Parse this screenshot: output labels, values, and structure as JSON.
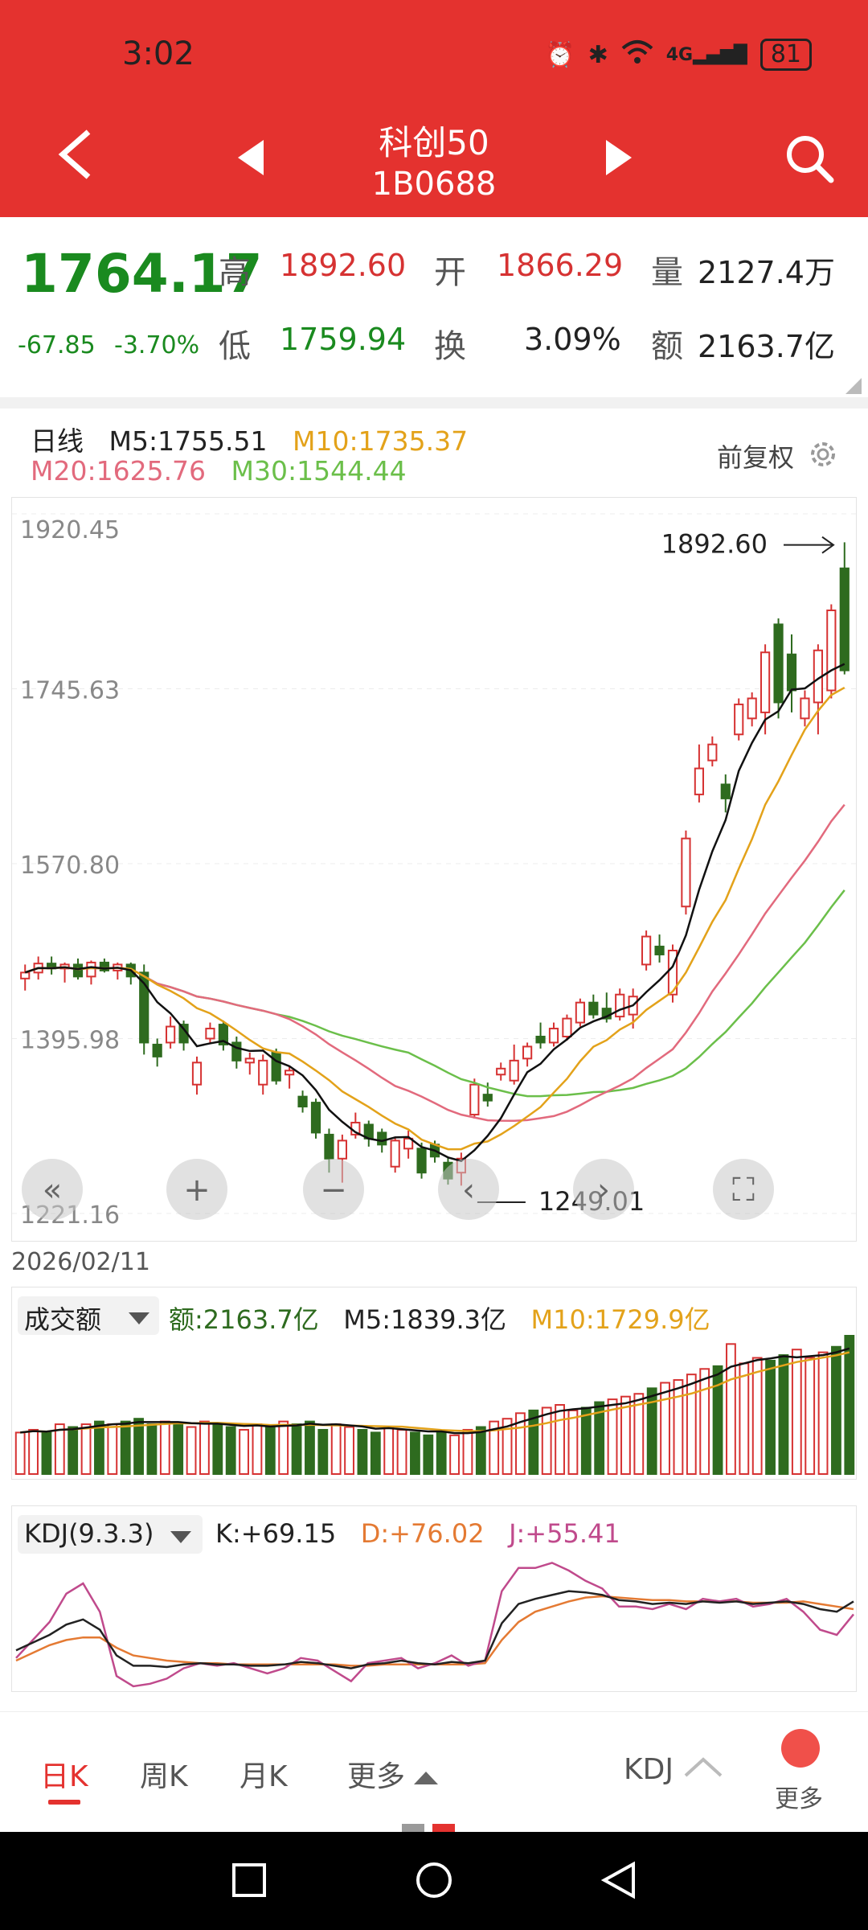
{
  "status": {
    "time": "3:02",
    "network": "4G",
    "battery": "81"
  },
  "header": {
    "title": "科创50",
    "code": "1B0688"
  },
  "quote": {
    "price": "1764.17",
    "change": "-67.85",
    "change_pct": "-3.70%",
    "high_label": "高",
    "high": "1892.60",
    "open_label": "开",
    "open": "1866.29",
    "volume_label": "量",
    "volume": "2127.4万",
    "low_label": "低",
    "low": "1759.94",
    "turnover_label": "换",
    "turnover": "3.09%",
    "amount_label": "额",
    "amount": "2163.7亿"
  },
  "ma_legend": {
    "period": "日线",
    "m5": "M5:1755.51",
    "m10": "M10:1735.37",
    "m20": "M20:1625.76",
    "m30": "M30:1544.44",
    "adjust": "前复权"
  },
  "colors": {
    "up": "#d63232",
    "down": "#2e6b1f",
    "m5": "#111111",
    "m10": "#e3a21a",
    "m20": "#e26a7d",
    "m30": "#6bbf4a",
    "accent": "#e4322f"
  },
  "chart_data": [
    {
      "type": "candlestick",
      "title": "",
      "y_ticks": [
        "1920.45",
        "1745.63",
        "1570.80",
        "1395.98",
        "1221.16"
      ],
      "ylim": [
        1221.16,
        1920.45
      ],
      "x_date": "2026/02/11",
      "high_marker": "1892.60",
      "low_marker": "1249.01",
      "candles": [
        {
          "o": 1456,
          "h": 1470,
          "l": 1444,
          "c": 1462
        },
        {
          "o": 1462,
          "h": 1478,
          "l": 1455,
          "c": 1471
        },
        {
          "o": 1471,
          "h": 1478,
          "l": 1460,
          "c": 1466
        },
        {
          "o": 1466,
          "h": 1472,
          "l": 1452,
          "c": 1470
        },
        {
          "o": 1470,
          "h": 1476,
          "l": 1455,
          "c": 1458
        },
        {
          "o": 1458,
          "h": 1474,
          "l": 1450,
          "c": 1472
        },
        {
          "o": 1472,
          "h": 1476,
          "l": 1462,
          "c": 1464
        },
        {
          "o": 1464,
          "h": 1472,
          "l": 1455,
          "c": 1470
        },
        {
          "o": 1470,
          "h": 1472,
          "l": 1450,
          "c": 1458
        },
        {
          "o": 1462,
          "h": 1470,
          "l": 1380,
          "c": 1392
        },
        {
          "o": 1390,
          "h": 1396,
          "l": 1368,
          "c": 1378
        },
        {
          "o": 1392,
          "h": 1418,
          "l": 1386,
          "c": 1408
        },
        {
          "o": 1410,
          "h": 1414,
          "l": 1384,
          "c": 1392
        },
        {
          "o": 1350,
          "h": 1378,
          "l": 1340,
          "c": 1372
        },
        {
          "o": 1396,
          "h": 1412,
          "l": 1392,
          "c": 1406
        },
        {
          "o": 1410,
          "h": 1414,
          "l": 1384,
          "c": 1390
        },
        {
          "o": 1392,
          "h": 1398,
          "l": 1366,
          "c": 1374
        },
        {
          "o": 1372,
          "h": 1382,
          "l": 1360,
          "c": 1376
        },
        {
          "o": 1350,
          "h": 1380,
          "l": 1340,
          "c": 1374
        },
        {
          "o": 1382,
          "h": 1386,
          "l": 1350,
          "c": 1354
        },
        {
          "o": 1360,
          "h": 1368,
          "l": 1346,
          "c": 1364
        },
        {
          "o": 1338,
          "h": 1344,
          "l": 1322,
          "c": 1328
        },
        {
          "o": 1332,
          "h": 1336,
          "l": 1296,
          "c": 1302
        },
        {
          "o": 1300,
          "h": 1306,
          "l": 1262,
          "c": 1276
        },
        {
          "o": 1276,
          "h": 1300,
          "l": 1252,
          "c": 1294
        },
        {
          "o": 1300,
          "h": 1322,
          "l": 1296,
          "c": 1312
        },
        {
          "o": 1310,
          "h": 1314,
          "l": 1288,
          "c": 1296
        },
        {
          "o": 1302,
          "h": 1306,
          "l": 1282,
          "c": 1290
        },
        {
          "o": 1268,
          "h": 1298,
          "l": 1262,
          "c": 1294
        },
        {
          "o": 1286,
          "h": 1304,
          "l": 1276,
          "c": 1296
        },
        {
          "o": 1286,
          "h": 1292,
          "l": 1256,
          "c": 1262
        },
        {
          "o": 1290,
          "h": 1294,
          "l": 1272,
          "c": 1278
        },
        {
          "o": 1272,
          "h": 1278,
          "l": 1250,
          "c": 1256
        },
        {
          "o": 1262,
          "h": 1282,
          "l": 1249,
          "c": 1276
        },
        {
          "o": 1320,
          "h": 1356,
          "l": 1316,
          "c": 1350
        },
        {
          "o": 1340,
          "h": 1352,
          "l": 1328,
          "c": 1334
        },
        {
          "o": 1360,
          "h": 1372,
          "l": 1354,
          "c": 1366
        },
        {
          "o": 1354,
          "h": 1390,
          "l": 1350,
          "c": 1374
        },
        {
          "o": 1376,
          "h": 1392,
          "l": 1368,
          "c": 1388
        },
        {
          "o": 1398,
          "h": 1412,
          "l": 1386,
          "c": 1392
        },
        {
          "o": 1392,
          "h": 1412,
          "l": 1388,
          "c": 1406
        },
        {
          "o": 1398,
          "h": 1420,
          "l": 1394,
          "c": 1416
        },
        {
          "o": 1412,
          "h": 1436,
          "l": 1408,
          "c": 1432
        },
        {
          "o": 1432,
          "h": 1440,
          "l": 1416,
          "c": 1420
        },
        {
          "o": 1426,
          "h": 1442,
          "l": 1412,
          "c": 1416
        },
        {
          "o": 1418,
          "h": 1446,
          "l": 1414,
          "c": 1440
        },
        {
          "o": 1420,
          "h": 1446,
          "l": 1406,
          "c": 1438
        },
        {
          "o": 1470,
          "h": 1504,
          "l": 1464,
          "c": 1498
        },
        {
          "o": 1488,
          "h": 1500,
          "l": 1472,
          "c": 1480
        },
        {
          "o": 1440,
          "h": 1490,
          "l": 1432,
          "c": 1484
        },
        {
          "o": 1528,
          "h": 1604,
          "l": 1520,
          "c": 1596
        },
        {
          "o": 1640,
          "h": 1690,
          "l": 1632,
          "c": 1666
        },
        {
          "o": 1674,
          "h": 1698,
          "l": 1668,
          "c": 1690
        },
        {
          "o": 1650,
          "h": 1660,
          "l": 1622,
          "c": 1636
        },
        {
          "o": 1700,
          "h": 1736,
          "l": 1694,
          "c": 1730
        },
        {
          "o": 1716,
          "h": 1742,
          "l": 1708,
          "c": 1736
        },
        {
          "o": 1722,
          "h": 1790,
          "l": 1700,
          "c": 1782
        },
        {
          "o": 1810,
          "h": 1816,
          "l": 1716,
          "c": 1732
        },
        {
          "o": 1780,
          "h": 1800,
          "l": 1722,
          "c": 1744
        },
        {
          "o": 1716,
          "h": 1744,
          "l": 1708,
          "c": 1736
        },
        {
          "o": 1732,
          "h": 1790,
          "l": 1700,
          "c": 1784
        },
        {
          "o": 1744,
          "h": 1830,
          "l": 1736,
          "c": 1824
        },
        {
          "o": 1866,
          "h": 1892,
          "l": 1760,
          "c": 1764
        }
      ]
    },
    {
      "type": "bar",
      "title": "成交额",
      "label_amount": "额:2163.7亿",
      "label_m5": "M5:1839.3亿",
      "label_m10": "M10:1729.9亿",
      "values_pct": [
        30,
        32,
        30,
        36,
        34,
        36,
        38,
        36,
        38,
        40,
        36,
        38,
        36,
        34,
        38,
        36,
        34,
        32,
        36,
        34,
        38,
        36,
        38,
        32,
        36,
        34,
        32,
        30,
        34,
        32,
        30,
        28,
        30,
        28,
        32,
        34,
        38,
        40,
        44,
        46,
        48,
        50,
        46,
        48,
        52,
        54,
        56,
        58,
        62,
        66,
        68,
        72,
        76,
        78,
        94,
        80,
        84,
        82,
        86,
        90,
        84,
        88,
        92,
        100
      ]
    },
    {
      "type": "line",
      "title": "KDJ(9.3.3)",
      "label_k": "K:+69.15",
      "label_d": "D:+76.02",
      "label_j": "J:+55.41",
      "k": [
        28,
        34,
        40,
        48,
        52,
        44,
        24,
        16,
        16,
        15,
        17,
        18,
        17,
        17,
        16,
        16,
        17,
        19,
        18,
        16,
        14,
        17,
        18,
        20,
        18,
        17,
        19,
        18,
        20,
        49,
        64,
        68,
        71,
        74,
        73,
        71,
        67,
        66,
        64,
        65,
        64,
        66,
        65,
        66,
        64,
        65,
        66,
        64,
        60,
        58,
        66
      ],
      "d": [
        20,
        26,
        32,
        36,
        38,
        38,
        30,
        24,
        22,
        20,
        19,
        18,
        18,
        17,
        17,
        17,
        17,
        17,
        17,
        17,
        16,
        16,
        17,
        17,
        17,
        17,
        17,
        17,
        18,
        36,
        50,
        58,
        62,
        66,
        69,
        70,
        69,
        68,
        67,
        67,
        66,
        66,
        66,
        66,
        65,
        65,
        65,
        66,
        64,
        62,
        60
      ],
      "j": [
        22,
        36,
        50,
        72,
        80,
        58,
        8,
        0,
        2,
        6,
        14,
        18,
        16,
        18,
        14,
        10,
        14,
        22,
        20,
        12,
        4,
        18,
        20,
        22,
        14,
        18,
        24,
        16,
        20,
        74,
        92,
        92,
        96,
        90,
        82,
        76,
        62,
        62,
        60,
        64,
        60,
        68,
        66,
        68,
        62,
        64,
        68,
        58,
        44,
        40,
        56
      ]
    }
  ],
  "tabs": {
    "day": "日K",
    "week": "周K",
    "month": "月K",
    "more": "更多",
    "indicator": "KDJ",
    "more_btn": "更多"
  }
}
